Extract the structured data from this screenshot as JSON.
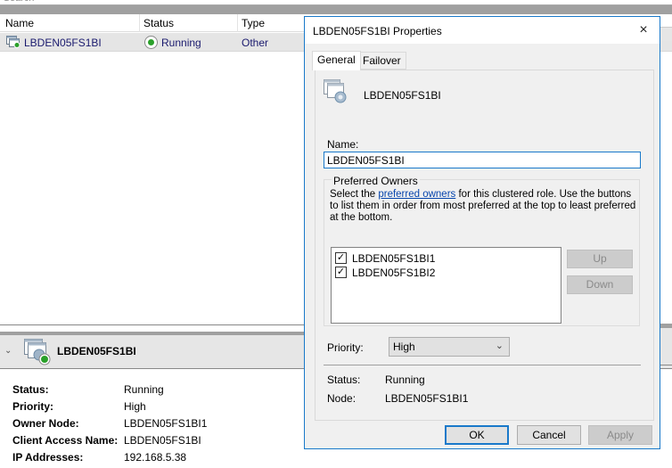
{
  "background": {
    "search_placeholder": "Search",
    "columns": [
      "Name",
      "Status",
      "Type"
    ],
    "rows": [
      {
        "name": "LBDEN05FS1BI",
        "status": "Running",
        "type": "Other"
      }
    ],
    "detail": {
      "title": "LBDEN05FS1BI",
      "fields": [
        {
          "label": "Status:",
          "value": "Running"
        },
        {
          "label": "Priority:",
          "value": "High"
        },
        {
          "label": "Owner Node:",
          "value": "LBDEN05FS1BI1"
        },
        {
          "label": "Client Access Name:",
          "value": "LBDEN05FS1BI"
        },
        {
          "label": "IP Addresses:",
          "value": "192.168.5.38"
        }
      ]
    }
  },
  "dialog": {
    "title": "LBDEN05FS1BI Properties",
    "close_icon": "×",
    "tabs": [
      {
        "label": "General",
        "active": true
      },
      {
        "label": "Failover",
        "active": false
      }
    ],
    "role_name": "LBDEN05FS1BI",
    "name_label": "Name:",
    "name_value": "LBDEN05FS1BI",
    "preferred_owners": {
      "legend": "Preferred Owners",
      "desc_before": "Select the ",
      "desc_link": "preferred owners",
      "desc_after": " for this clustered role. Use the buttons to list them in order from most preferred at the top to least preferred at the bottom.",
      "owners": [
        {
          "name": "LBDEN05FS1BI1",
          "checked": true
        },
        {
          "name": "LBDEN05FS1BI2",
          "checked": true
        }
      ],
      "up_label": "Up",
      "down_label": "Down"
    },
    "priority_label": "Priority:",
    "priority_value": "High",
    "status_label": "Status:",
    "status_value": "Running",
    "node_label": "Node:",
    "node_value": "LBDEN05FS1BI1",
    "ok_label": "OK",
    "cancel_label": "Cancel",
    "apply_label": "Apply",
    "colors": {
      "accent": "#1979ca",
      "running": "#2aa02a"
    }
  }
}
